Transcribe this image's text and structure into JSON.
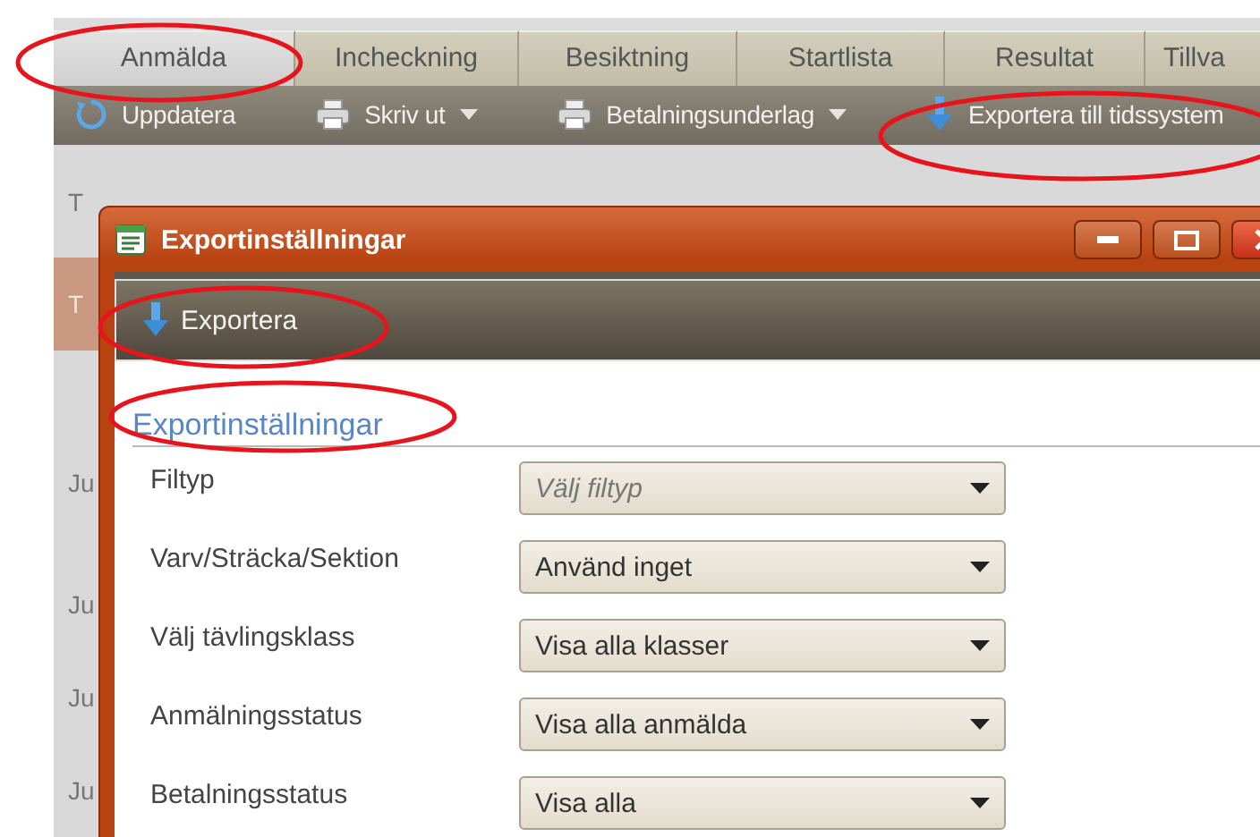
{
  "app": {
    "tabs": [
      {
        "label": "Anmälda",
        "selected": true
      },
      {
        "label": "Incheckning",
        "selected": false
      },
      {
        "label": "Besiktning",
        "selected": false
      },
      {
        "label": "Startlista",
        "selected": false
      },
      {
        "label": "Resultat",
        "selected": false
      },
      {
        "label": "Tillva",
        "selected": false
      }
    ],
    "toolbar": [
      {
        "label": "Uppdatera",
        "kind": "refresh",
        "has_menu": false
      },
      {
        "label": "Skriv ut",
        "kind": "print",
        "has_menu": true
      },
      {
        "label": "Betalningsunderlag",
        "kind": "print",
        "has_menu": true
      },
      {
        "label": "Exportera till tidssystem",
        "kind": "download",
        "has_menu": false
      }
    ],
    "list_rows": [
      {
        "text": "T",
        "highlighted": false
      },
      {
        "text": "T",
        "highlighted": true
      },
      {
        "text": "Ju",
        "highlighted": false
      },
      {
        "text": "Ju",
        "highlighted": false
      },
      {
        "text": "Ju",
        "highlighted": false
      },
      {
        "text": "Ju",
        "highlighted": false
      }
    ]
  },
  "dialog": {
    "title": "Exportinställningar",
    "toolbar_button": "Exportera",
    "section_title": "Exportinställningar",
    "fields": [
      {
        "label": "Filtyp",
        "placeholder": "Välj filtyp"
      },
      {
        "label": "Varv/Sträcka/Sektion",
        "value": "Använd inget"
      },
      {
        "label": "Välj tävlingsklass",
        "value": "Visa alla klasser"
      },
      {
        "label": "Anmälningsstatus",
        "value": "Visa alla anmälda"
      },
      {
        "label": "Betalningsstatus",
        "value": "Visa alla"
      }
    ]
  }
}
